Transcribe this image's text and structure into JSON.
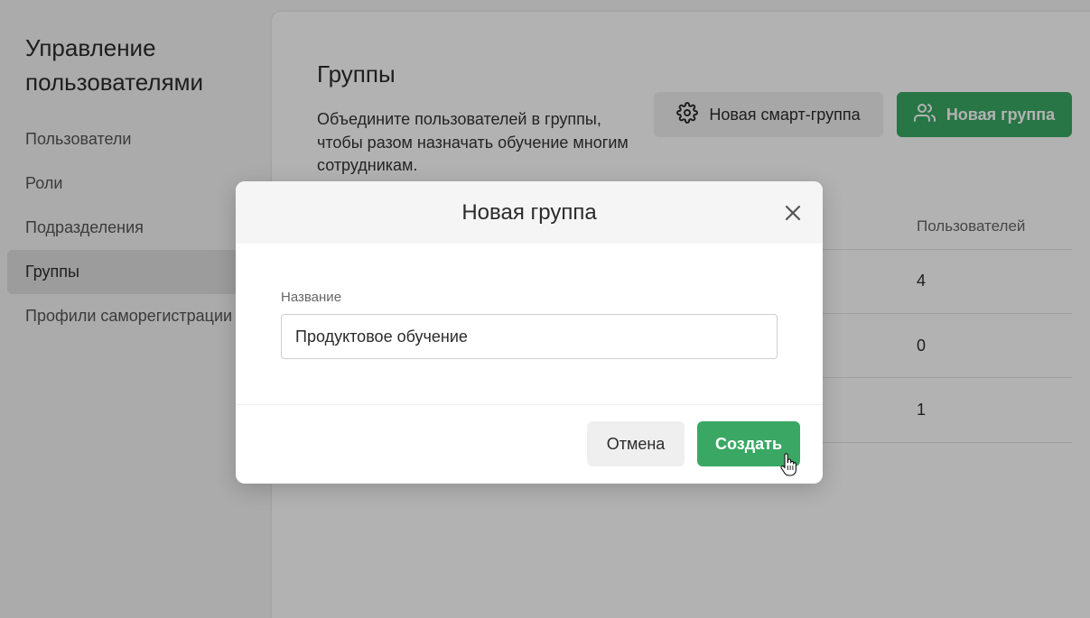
{
  "sidebar": {
    "title": "Управление пользователями",
    "items": [
      {
        "label": "Пользователи"
      },
      {
        "label": "Роли"
      },
      {
        "label": "Подразделения"
      },
      {
        "label": "Группы"
      },
      {
        "label": "Профили саморегистрации"
      }
    ],
    "active_index": 3
  },
  "main": {
    "title": "Группы",
    "description": "Объедините пользователей в группы, чтобы разом назначать обучение многим сотрудникам.",
    "smart_group_button": "Новая смарт-группа",
    "smart_group_icon": "gear-icon",
    "new_group_button": "Новая группа",
    "new_group_icon": "users-icon",
    "table": {
      "column_header": "Пользователей",
      "rows": [
        {
          "users": "4"
        },
        {
          "users": "0"
        },
        {
          "users": "1"
        }
      ]
    }
  },
  "modal": {
    "title": "Новая группа",
    "close_icon": "close-icon",
    "field_label": "Название",
    "field_value": "Продуктовое обучение",
    "cancel_button": "Отмена",
    "create_button": "Создать"
  },
  "colors": {
    "accent": "#3aa864",
    "overlay": "rgba(0,0,0,0.30)",
    "sidebar_bg": "#f5f5f5"
  }
}
